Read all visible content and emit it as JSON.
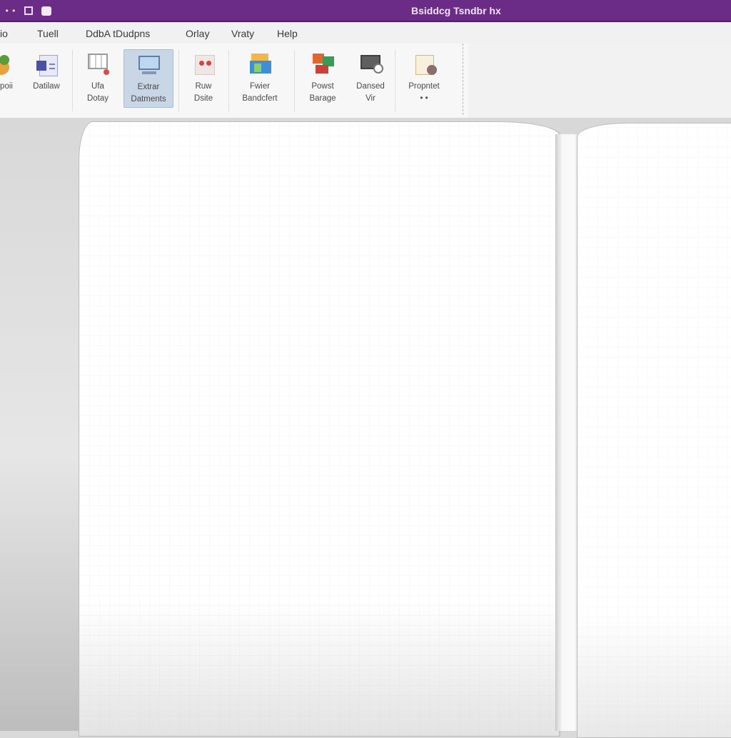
{
  "window": {
    "title": "Bsiddcg Tsndbr hx",
    "accent_color": "#6a2c86"
  },
  "quick_access": {
    "icons": [
      "more-icon",
      "grid-icon",
      "save-icon"
    ]
  },
  "menu": {
    "items": [
      "io",
      "Tuell",
      "DdbA tDudpns",
      "Orlay",
      "Vraty",
      "Help"
    ]
  },
  "ribbon": {
    "buttons": [
      {
        "icon": "shapes-icon",
        "line1": "poii",
        "line2": ""
      },
      {
        "icon": "document-icon",
        "line1": "Datilaw",
        "line2": ""
      },
      {
        "icon": "grid-layout-icon",
        "line1": "Ufa",
        "line2": "Dotay"
      },
      {
        "icon": "monitor-icon",
        "line1": "Extrar",
        "line2": "Datments",
        "selected": true
      },
      {
        "icon": "rule-icon",
        "line1": "Ruw",
        "line2": "Dsite"
      },
      {
        "icon": "palette-icon",
        "line1": "Fwier",
        "line2": "Bandcfert"
      },
      {
        "icon": "brush-icon",
        "line1": "Powst",
        "line2": "Barage"
      },
      {
        "icon": "screen-icon",
        "line1": "Dansed",
        "line2": "Vir"
      },
      {
        "icon": "properties-icon",
        "line1": "Propntet",
        "line2": "• •"
      }
    ]
  }
}
